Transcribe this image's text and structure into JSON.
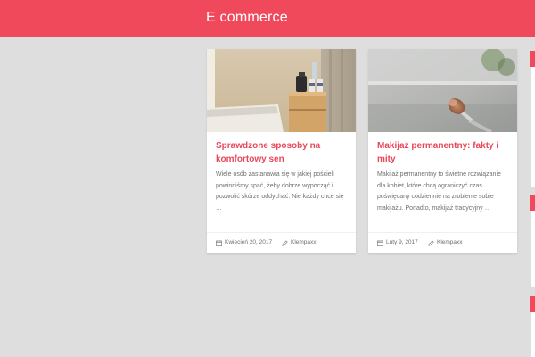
{
  "header": {
    "site_title": "E commerce"
  },
  "colors": {
    "brand": "#f0495b",
    "title": "#e8485a",
    "background": "#dedede",
    "card": "#ffffff"
  },
  "posts": [
    {
      "title": "Sprawdzone sposoby na komfortowy sen",
      "excerpt": "Wiele osób zastanawia się w jakiej pościeli powinniśmy spać, żeby dobrze wypocząć i pozwolić skórze oddychać. Nie każdy chce się …",
      "date": "Kwiecień 20, 2017",
      "author": "Klempaxx",
      "image": "hotel-room-photo"
    },
    {
      "title": "Makijaż permanentny: fakty i mity",
      "excerpt": "Makijaż permanentny to świetne rozwiązanie dla kobiet, które chcą ograniczyć czas poświęcany codziennie na zrobienie sobie makijażu. Ponadto, makijaż tradycyjny …",
      "date": "Luty 9, 2017",
      "author": "Klempaxx",
      "image": "makeup-brush-photo"
    }
  ],
  "icons": {
    "date": "calendar-icon",
    "author": "pencil-icon"
  }
}
